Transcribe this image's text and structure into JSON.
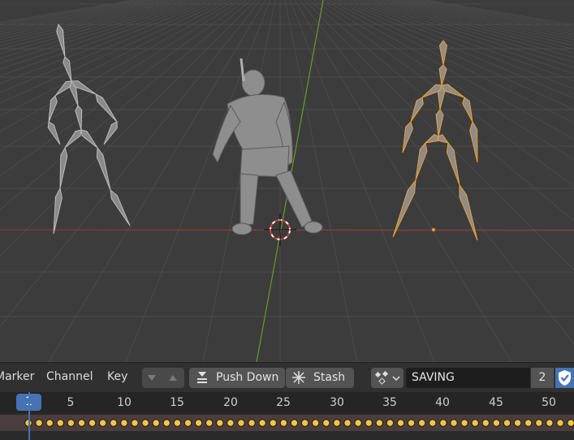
{
  "viewport": {
    "scene": "3D viewport with armature skeletons and character mesh",
    "colors": {
      "background": "#3c3c3c",
      "grid": "#4a4a4a",
      "x_axis": "#8a3a3a",
      "y_axis": "#6a9a2a",
      "selected_armature": "#f0a030",
      "armature": "#9a9a9a"
    }
  },
  "timeline": {
    "menu": {
      "marker": "Marker",
      "channel": "Channel",
      "key": "Key"
    },
    "push_down_label": "Push Down",
    "stash_label": "Stash",
    "action_name": "SAVING",
    "user_count": "2",
    "current_frame": "1",
    "ruler_ticks": [
      "5",
      "10",
      "15",
      "20",
      "25",
      "30",
      "35",
      "40",
      "45",
      "50"
    ],
    "accent": "#4772b3",
    "keyframe_color": "#f5c542"
  }
}
